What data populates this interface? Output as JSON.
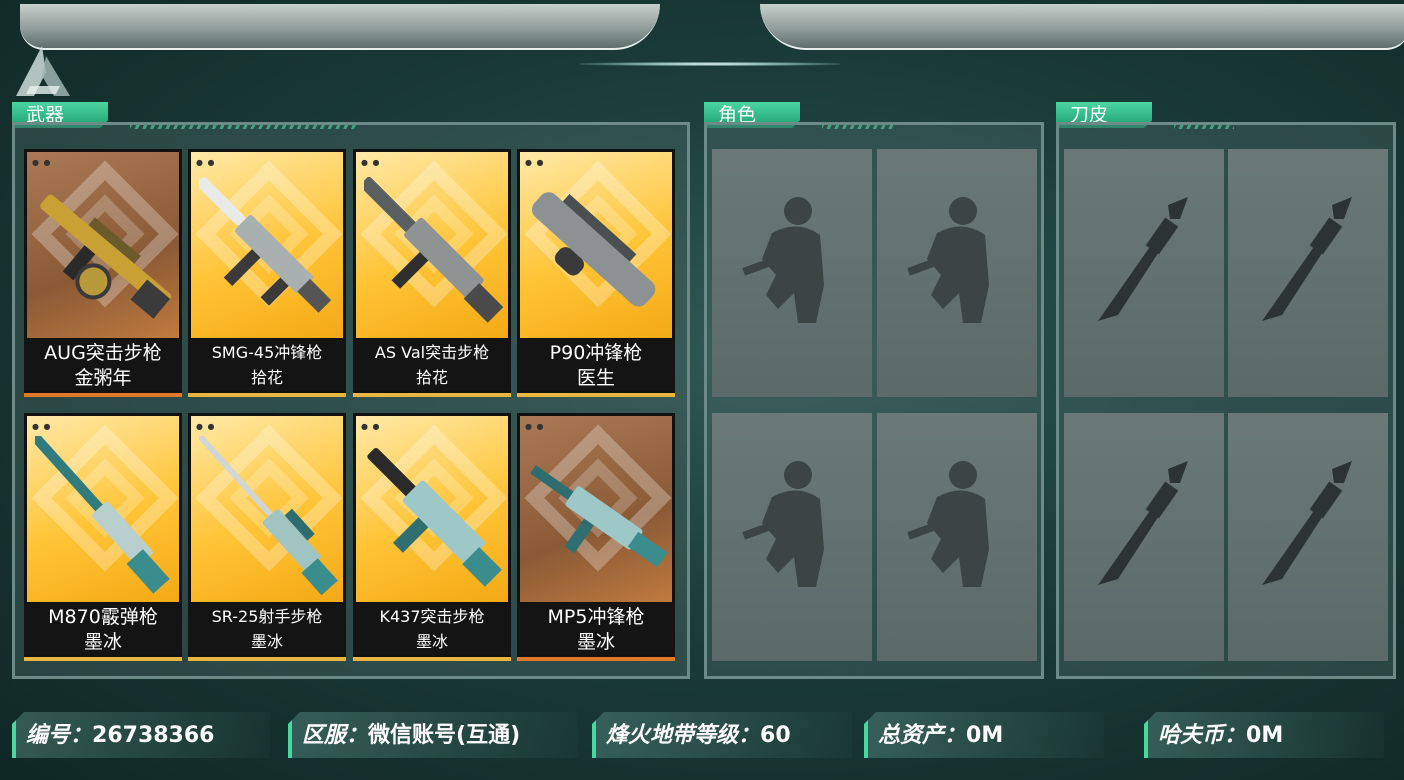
{
  "sections": {
    "weapons": "武器",
    "roles": "角色",
    "knives": "刀皮"
  },
  "weapons": [
    {
      "line1": "AUG突击步枪",
      "line2": "金粥年",
      "style": "brown"
    },
    {
      "line1": "SMG-45冲锋枪",
      "line2": "拾花",
      "style": "gold"
    },
    {
      "line1": "AS Val突击步枪",
      "line2": "拾花",
      "style": "gold"
    },
    {
      "line1": "P90冲锋枪",
      "line2": "医生",
      "style": "gold"
    },
    {
      "line1": "M870霰弹枪",
      "line2": "墨冰",
      "style": "gold"
    },
    {
      "line1": "SR-25射手步枪",
      "line2": "墨冰",
      "style": "gold"
    },
    {
      "line1": "K437突击步枪",
      "line2": "墨冰",
      "style": "gold"
    },
    {
      "line1": "MP5冲锋枪",
      "line2": "墨冰",
      "style": "brown"
    }
  ],
  "footer": {
    "id_label": "编号：",
    "id_value": "26738366",
    "server_label": "区服：",
    "server_value": "微信账号(互通)",
    "level_label": "烽火地带等级：",
    "level_value": "60",
    "assets_label": "总资产：",
    "assets_value": "0M",
    "coin_label": "哈夫币：",
    "coin_value": "0M"
  },
  "colors": {
    "accent": "#3fd39a",
    "card_gold": "#ffc436",
    "card_brown": "#8a5a36"
  }
}
